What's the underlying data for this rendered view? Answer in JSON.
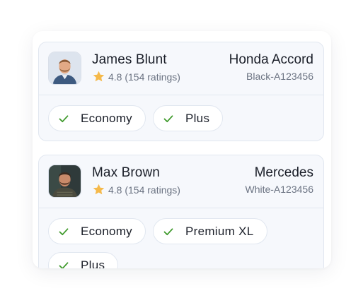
{
  "drivers": [
    {
      "name": "James Blunt",
      "rating": "4.8 (154 ratings)",
      "car_model": "Honda Accord",
      "car_plate": "Black-A123456",
      "options": [
        "Economy",
        "Plus"
      ]
    },
    {
      "name": "Max Brown",
      "rating": "4.8 (154 ratings)",
      "car_model": "Mercedes",
      "car_plate": "White-A123456",
      "options": [
        "Economy",
        "Premium XL",
        "Plus"
      ]
    }
  ],
  "icons": {
    "star": "star-icon",
    "check": "check-icon"
  },
  "colors": {
    "star": "#f5b94a",
    "check": "#3f9a2c",
    "card_bg": "#f6f8fc",
    "border": "#e1e7f0"
  }
}
